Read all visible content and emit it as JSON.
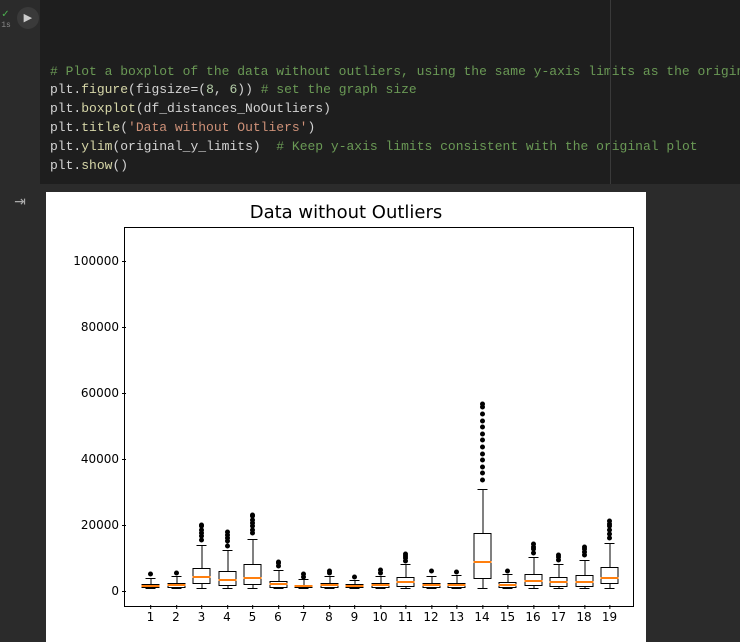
{
  "cell": {
    "status_glyph": "✓",
    "timing": "1s",
    "run_glyph": "▶",
    "code_lines": [
      [
        {
          "t": "# Plot a boxplot of the data without outliers, using the same y-axis limits as the original plot",
          "cls": "c"
        }
      ],
      [
        {
          "t": "plt",
          "cls": "id"
        },
        {
          "t": ".",
          "cls": "pn"
        },
        {
          "t": "figure",
          "cls": "fn"
        },
        {
          "t": "(",
          "cls": "pn"
        },
        {
          "t": "figsize",
          "cls": "id"
        },
        {
          "t": "=(",
          "cls": "pn"
        },
        {
          "t": "8",
          "cls": "num"
        },
        {
          "t": ", ",
          "cls": "pn"
        },
        {
          "t": "6",
          "cls": "num"
        },
        {
          "t": "))",
          "cls": "pn"
        },
        {
          "t": " # set the graph size",
          "cls": "c"
        }
      ],
      [
        {
          "t": "plt",
          "cls": "id"
        },
        {
          "t": ".",
          "cls": "pn"
        },
        {
          "t": "boxplot",
          "cls": "fn"
        },
        {
          "t": "(",
          "cls": "pn"
        },
        {
          "t": "df_distances_NoOutliers",
          "cls": "id"
        },
        {
          "t": ")",
          "cls": "pn"
        }
      ],
      [
        {
          "t": "plt",
          "cls": "id"
        },
        {
          "t": ".",
          "cls": "pn"
        },
        {
          "t": "title",
          "cls": "fn"
        },
        {
          "t": "(",
          "cls": "pn"
        },
        {
          "t": "'Data without Outliers'",
          "cls": "str"
        },
        {
          "t": ")",
          "cls": "pn"
        }
      ],
      [
        {
          "t": "plt",
          "cls": "id"
        },
        {
          "t": ".",
          "cls": "pn"
        },
        {
          "t": "ylim",
          "cls": "fn"
        },
        {
          "t": "(",
          "cls": "pn"
        },
        {
          "t": "original_y_limits",
          "cls": "id"
        },
        {
          "t": ")",
          "cls": "pn"
        },
        {
          "t": "  # Keep y-axis limits consistent with the original plot",
          "cls": "c"
        }
      ],
      [
        {
          "t": "plt",
          "cls": "id"
        },
        {
          "t": ".",
          "cls": "pn"
        },
        {
          "t": "show",
          "cls": "fn"
        },
        {
          "t": "()",
          "cls": "pn"
        }
      ]
    ]
  },
  "output_gutter_glyph": "⇥",
  "chart_data": {
    "type": "boxplot",
    "title": "Data without Outliers",
    "xlabel": "",
    "ylabel": "",
    "ylim": [
      -5000,
      110000
    ],
    "yticks": [
      0,
      20000,
      40000,
      60000,
      80000,
      100000
    ],
    "categories": [
      "1",
      "2",
      "3",
      "4",
      "5",
      "6",
      "7",
      "8",
      "9",
      "10",
      "11",
      "12",
      "13",
      "14",
      "15",
      "16",
      "17",
      "18",
      "19"
    ],
    "series": [
      {
        "q1": 300,
        "median": 700,
        "q3": 1500,
        "whisker_low": 0,
        "whisker_high": 3200,
        "fliers": [
          4500
        ]
      },
      {
        "q1": 400,
        "median": 900,
        "q3": 1800,
        "whisker_low": 0,
        "whisker_high": 3800,
        "fliers": [
          5000
        ]
      },
      {
        "q1": 1500,
        "median": 3500,
        "q3": 6500,
        "whisker_low": 0,
        "whisker_high": 13000,
        "fliers": [
          15000,
          16000,
          17000,
          18000,
          19000,
          19500
        ]
      },
      {
        "q1": 800,
        "median": 2500,
        "q3": 5500,
        "whisker_low": 0,
        "whisker_high": 11500,
        "fliers": [
          13000,
          14500,
          15500,
          16500,
          17200
        ]
      },
      {
        "q1": 1200,
        "median": 3200,
        "q3": 7500,
        "whisker_low": 0,
        "whisker_high": 15000,
        "fliers": [
          17000,
          18000,
          19000,
          20000,
          21000,
          22000,
          22500
        ]
      },
      {
        "q1": 400,
        "median": 1200,
        "q3": 2600,
        "whisker_low": 0,
        "whisker_high": 5500,
        "fliers": [
          7000,
          7800,
          8300
        ]
      },
      {
        "q1": 200,
        "median": 600,
        "q3": 1300,
        "whisker_low": 0,
        "whisker_high": 2800,
        "fliers": [
          3800,
          4500
        ]
      },
      {
        "q1": 300,
        "median": 800,
        "q3": 1700,
        "whisker_low": 0,
        "whisker_high": 3600,
        "fliers": [
          4800,
          5500
        ]
      },
      {
        "q1": 250,
        "median": 650,
        "q3": 1400,
        "whisker_low": 0,
        "whisker_high": 2400,
        "fliers": [
          3600
        ]
      },
      {
        "q1": 300,
        "median": 900,
        "q3": 1900,
        "whisker_low": 0,
        "whisker_high": 3800,
        "fliers": [
          5000,
          5700
        ]
      },
      {
        "q1": 600,
        "median": 1700,
        "q3": 3600,
        "whisker_low": 0,
        "whisker_high": 7200,
        "fliers": [
          8500,
          9300,
          10000,
          10600
        ]
      },
      {
        "q1": 300,
        "median": 800,
        "q3": 1800,
        "whisker_low": 0,
        "whisker_high": 3700,
        "fliers": [
          5600
        ]
      },
      {
        "q1": 300,
        "median": 900,
        "q3": 1900,
        "whisker_low": 0,
        "whisker_high": 4000,
        "fliers": [
          5200
        ]
      },
      {
        "q1": 3000,
        "median": 8000,
        "q3": 17000,
        "whisker_low": 0,
        "whisker_high": 30000,
        "fliers": [
          33000,
          35000,
          37000,
          39000,
          41000,
          43000,
          45000,
          47000,
          49000,
          51000,
          53000,
          55000,
          56000
        ]
      },
      {
        "q1": 300,
        "median": 900,
        "q3": 2000,
        "whisker_low": 0,
        "whisker_high": 4200,
        "fliers": [
          5500
        ]
      },
      {
        "q1": 900,
        "median": 2200,
        "q3": 4700,
        "whisker_low": 0,
        "whisker_high": 9500,
        "fliers": [
          11000,
          12000,
          12800,
          13500
        ]
      },
      {
        "q1": 600,
        "median": 1700,
        "q3": 3600,
        "whisker_low": 0,
        "whisker_high": 7300,
        "fliers": [
          8800,
          9600,
          10300
        ]
      },
      {
        "q1": 700,
        "median": 1900,
        "q3": 4200,
        "whisker_low": 0,
        "whisker_high": 8600,
        "fliers": [
          10200,
          11200,
          12000,
          12700
        ]
      },
      {
        "q1": 1400,
        "median": 3200,
        "q3": 6800,
        "whisker_low": 0,
        "whisker_high": 13500,
        "fliers": [
          15500,
          16800,
          18000,
          19000,
          19800,
          20500
        ]
      }
    ]
  }
}
